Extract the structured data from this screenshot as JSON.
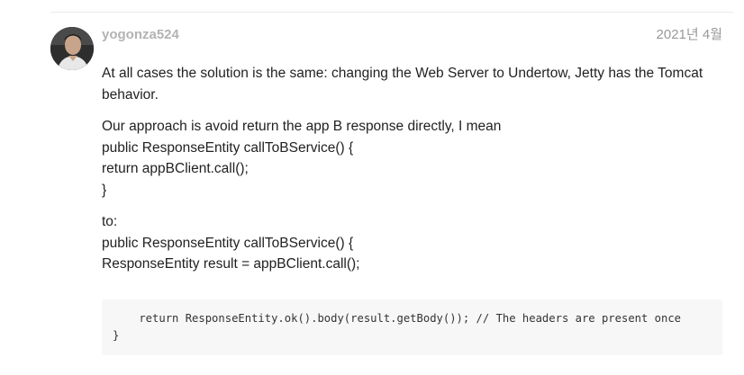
{
  "post": {
    "author": "yogonza524",
    "date": "2021년 4월",
    "paragraphs": [
      {
        "lines": [
          "At all cases the solution is the same: changing the Web Server to Undertow, Jetty has the Tomcat behavior."
        ]
      },
      {
        "lines": [
          "Our approach is avoid return the app B response directly, I mean",
          "public ResponseEntity callToBService() {",
          "return appBClient.call();",
          "}"
        ]
      },
      {
        "lines": [
          "to:",
          "public ResponseEntity callToBService() {",
          "ResponseEntity result = appBClient.call();"
        ]
      }
    ],
    "code_lines": [
      "    return ResponseEntity.ok().body(result.getBody()); // The headers are present once",
      "}"
    ]
  },
  "colors": {
    "author": "#b3b3b3",
    "date": "#999999",
    "text": "#222222",
    "code_background": "#f7f7f7"
  },
  "icons": {
    "avatar": "user-avatar-photo"
  }
}
